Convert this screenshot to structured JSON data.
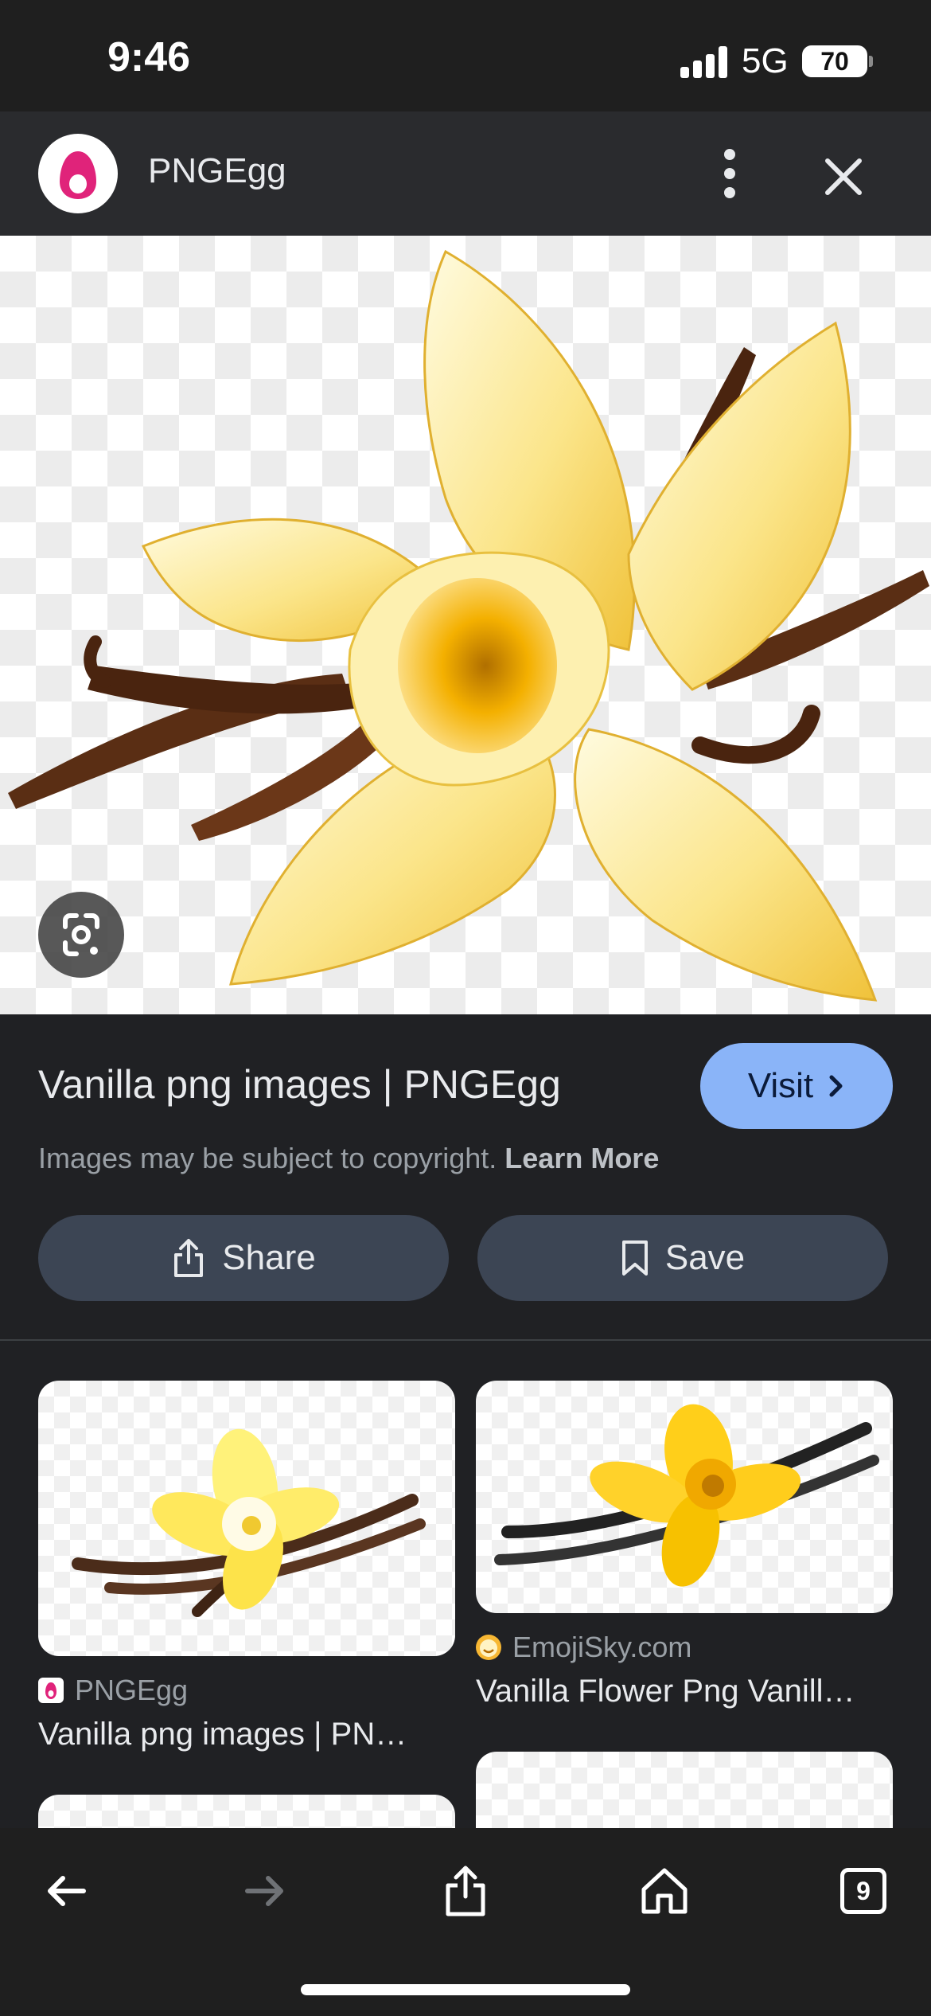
{
  "status": {
    "time": "9:46",
    "network": "5G",
    "battery": "70"
  },
  "header": {
    "site_name": "PNGEgg",
    "menu_icon": "more-vert-icon",
    "close_icon": "close-icon"
  },
  "hero": {
    "lens_icon": "lens-icon"
  },
  "result": {
    "title": "Vanilla png images | PNGEgg",
    "visit_label": "Visit",
    "copyright_text": "Images may be subject to copyright.",
    "learn_more": "Learn More"
  },
  "actions": {
    "share_label": "Share",
    "save_label": "Save"
  },
  "related": [
    {
      "source": "PNGEgg",
      "title": "Vanilla png images | PN…"
    },
    {
      "source": "EmojiSky.com",
      "title": "Vanilla Flower Png Vanill…"
    }
  ],
  "bottom_bar": {
    "tabs_count": "9"
  },
  "colors": {
    "accent": "#8ab4f8",
    "button_bg": "#3c4554",
    "background": "#202124"
  }
}
